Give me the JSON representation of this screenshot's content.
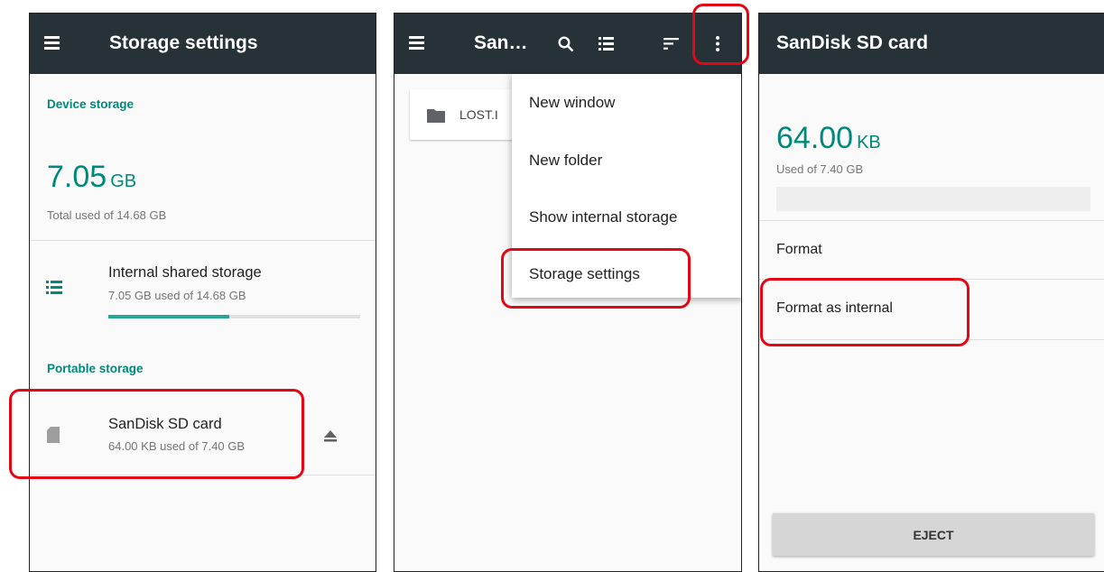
{
  "panel1": {
    "title": "Storage settings",
    "device_storage_header": "Device storage",
    "device_used_value": "7.05",
    "device_used_unit": "GB",
    "device_total_text": "Total used of 14.68 GB",
    "internal": {
      "title": "Internal shared storage",
      "subtitle": "7.05 GB used of 14.68 GB",
      "usage_fraction": 0.48
    },
    "portable_storage_header": "Portable storage",
    "sdcard": {
      "title": "SanDisk SD card",
      "subtitle": "64.00 KB used of 7.40 GB"
    }
  },
  "panel2": {
    "title": "San…",
    "list_item": "LOST.I",
    "menu_items": [
      "New window",
      "New folder",
      "Show internal storage",
      "Storage settings"
    ]
  },
  "panel3": {
    "title": "SanDisk SD card",
    "used_value": "64.00",
    "used_unit": "KB",
    "used_text": "Used of 7.40 GB",
    "actions": [
      "Format",
      "Format as internal"
    ],
    "eject_label": "EJECT"
  },
  "colors": {
    "app_bar": "#263238",
    "accent": "#00897b",
    "highlight": "#e30613"
  },
  "icons": [
    "menu-icon",
    "storage-list-icon",
    "sd-card-icon",
    "eject-icon",
    "search-icon",
    "list-view-icon",
    "sort-icon",
    "more-vert-icon",
    "folder-icon"
  ]
}
